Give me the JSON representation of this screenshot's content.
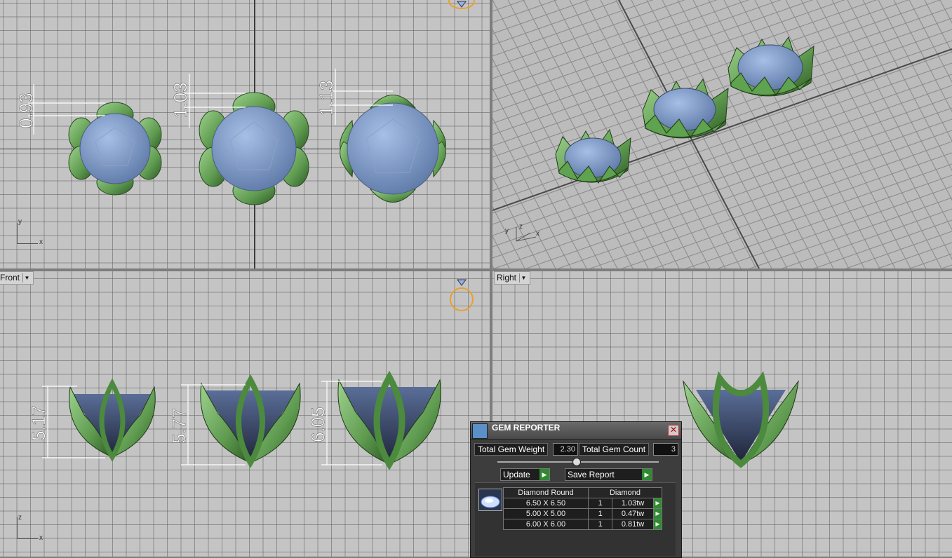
{
  "viewports": {
    "top": {
      "dimensions": [
        "0.93",
        "1.03",
        "1.13"
      ],
      "axis": {
        "v": "y",
        "h": "x"
      }
    },
    "perspective": {
      "axis": {
        "v": "y",
        "d": "z",
        "h": "x"
      }
    },
    "front": {
      "label": "Front",
      "dimensions": [
        "5.17",
        "5.77",
        "6.05"
      ],
      "axis": {
        "v": "z",
        "h": "x"
      }
    },
    "right": {
      "label": "Right"
    }
  },
  "gem_reporter": {
    "title": "GEM REPORTER",
    "close_symbol": "✕",
    "total_weight_label": "Total Gem Weight",
    "total_weight_value": "2.30",
    "total_count_label": "Total Gem Count",
    "total_count_value": "3",
    "update_label": "Update",
    "save_report_label": "Save Report",
    "table": {
      "headers": [
        "Diamond Round",
        "Diamond"
      ],
      "rows": [
        {
          "size": "6.50 X 6.50",
          "qty": "1",
          "weight": "1.03tw"
        },
        {
          "size": "5.00 X 5.00",
          "qty": "1",
          "weight": "0.47tw"
        },
        {
          "size": "6.00 X 6.00",
          "qty": "1",
          "weight": "0.81tw"
        }
      ]
    }
  },
  "colors": {
    "viewport_bg": "#c4c4c4",
    "gem_blue": "#7f9ccc",
    "prong_green": "#6fae5f",
    "go_green": "#2f8a2f"
  }
}
